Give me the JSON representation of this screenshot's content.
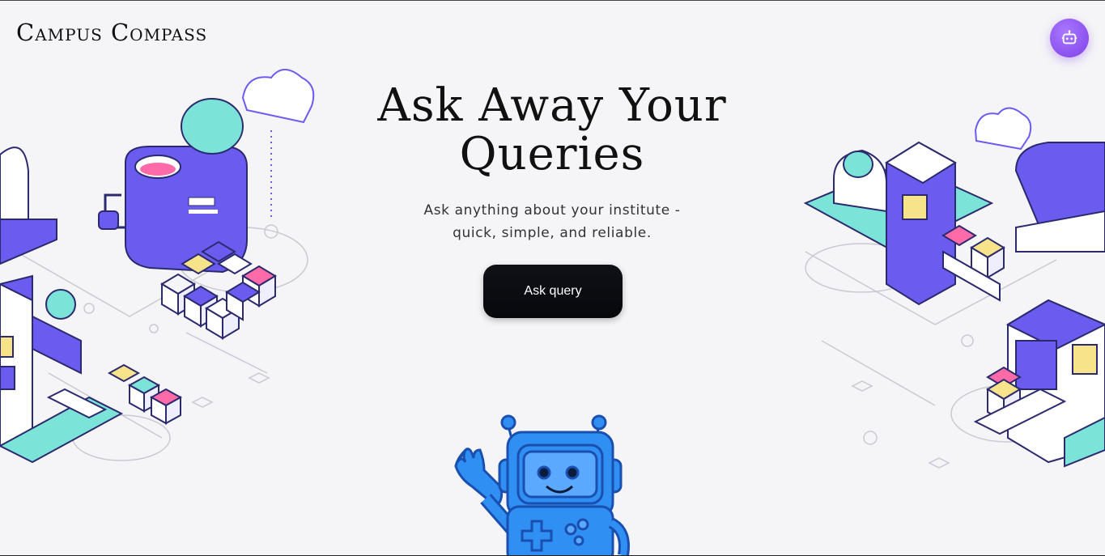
{
  "header": {
    "brand": "Campus Compass",
    "assistant_button_icon": "robot-icon"
  },
  "hero": {
    "title": "Ask Away Your Queries",
    "subtitle_line1": "Ask anything about your institute -",
    "subtitle_line2": "quick, simple, and reliable.",
    "cta_label": "Ask query"
  },
  "colors": {
    "accent_purple": "#7f3fe6",
    "illustration_indigo": "#6b5cf0",
    "illustration_mint": "#7be3d8",
    "mascot_blue": "#2f8ff3",
    "background": "#f5f5f7"
  }
}
